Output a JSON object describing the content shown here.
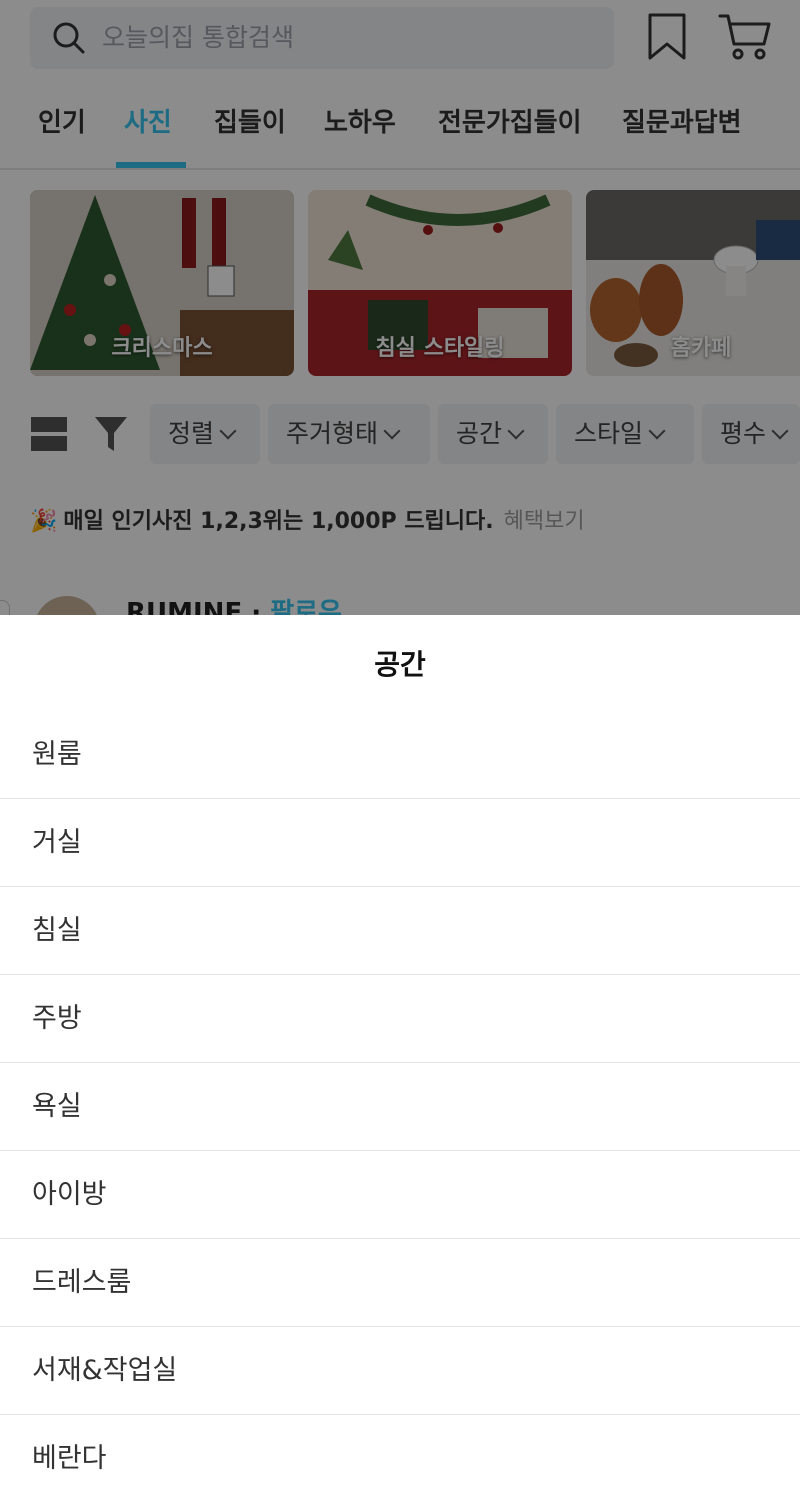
{
  "search": {
    "placeholder": "오늘의집 통합검색"
  },
  "tabs": [
    {
      "label": "인기",
      "active": false
    },
    {
      "label": "사진",
      "active": true
    },
    {
      "label": "집들이",
      "active": false
    },
    {
      "label": "노하우",
      "active": false
    },
    {
      "label": "전문가집들이",
      "active": false
    },
    {
      "label": "질문과답변",
      "active": false
    }
  ],
  "categories": [
    {
      "label": "크리스마스"
    },
    {
      "label": "침실 스타일링"
    },
    {
      "label": "홈카페"
    }
  ],
  "filters": [
    {
      "label": "정렬"
    },
    {
      "label": "주거형태"
    },
    {
      "label": "공간"
    },
    {
      "label": "스타일"
    },
    {
      "label": "평수"
    }
  ],
  "promo": {
    "icon": "party-popper-icon",
    "text": "매일 인기사진 1,2,3위는 1,000P 드립니다.",
    "link": "혜택보기"
  },
  "post": {
    "username": "RUMINE",
    "separator": "·",
    "follow": "팔로우"
  },
  "sheet": {
    "title": "공간",
    "items": [
      "원룸",
      "거실",
      "침실",
      "주방",
      "욕실",
      "아이방",
      "드레스룸",
      "서재&작업실",
      "베란다"
    ]
  },
  "colors": {
    "accent": "#35c5f0",
    "overlay": "rgba(0,0,0,0.45)"
  }
}
